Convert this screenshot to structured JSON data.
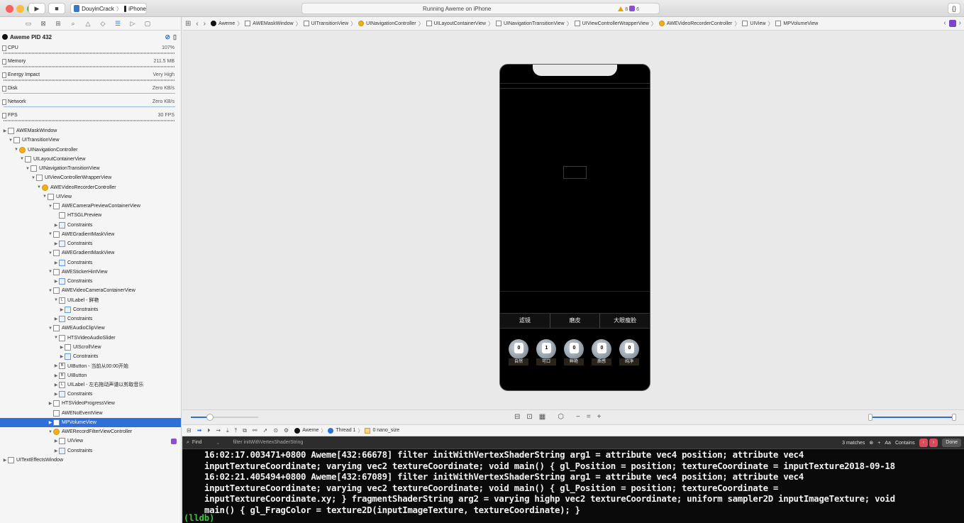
{
  "toolbar": {
    "scheme_app": "DouyinCrack",
    "scheme_device": "iPhone",
    "status": "Running Aweme on iPhone",
    "warnings": "8",
    "issues": "6",
    "right_btn": "{}"
  },
  "navigator": {
    "process": "Aweme PID 432",
    "gauges": [
      {
        "name": "CPU",
        "value": "107%"
      },
      {
        "name": "Memory",
        "value": "211.5 MB"
      },
      {
        "name": "Energy Impact",
        "value": "Very High"
      },
      {
        "name": "Disk",
        "value": "Zero KB/s"
      },
      {
        "name": "Network",
        "value": "Zero KB/s"
      },
      {
        "name": "FPS",
        "value": "30 FPS"
      }
    ],
    "tree": [
      "AWEMaskWindow",
      "UITransitionView",
      "UINavigationController",
      "UILayoutContainerView",
      "UINavigationTransitionView",
      "UIViewControllerWrapperView",
      "AWEVideoRecorderController",
      "UIView",
      "AWECameraPreviewContainerView",
      "HTSGLPreview",
      "Constraints",
      "AWEGradientMaskView",
      "Constraints",
      "AWEGradientMaskView",
      "Constraints",
      "AWEStickerHintView",
      "Constraints",
      "AWEVideoCameraContainerView",
      "UILabel - 鲜艳",
      "Constraints",
      "Constraints",
      "AWEAudioClipView",
      "HTSVideoAudioSlider",
      "UIScrollView",
      "Constraints",
      "UIButton - 当前从00:00开始",
      "UIButton",
      "UILabel - 左右拖动声谱以剪取音乐",
      "Constraints",
      "HTSVideoProgressView",
      "AWENoEventView",
      "MPVolumeView",
      "AWERecordFilterViewController",
      "UIView",
      "Constraints",
      "UITextEffectsWindow"
    ]
  },
  "jumpbar": {
    "crumbs": [
      "Aweme",
      "AWEMaskWindow",
      "UITransitionView",
      "UINavigationController",
      "UILayoutContainerView",
      "UINavigationTransitionView",
      "UIViewControllerWrapperView",
      "AWEVideoRecorderController",
      "UIView",
      "MPVolumeView"
    ]
  },
  "phone": {
    "tabs": [
      "滤镜",
      "磨皮",
      "大眼瘦脸"
    ],
    "filters": [
      {
        "num": "0",
        "label": "自然"
      },
      {
        "num": "1",
        "label": "可口"
      },
      {
        "num": "0",
        "label": "鲜艳"
      },
      {
        "num": "0",
        "label": "质感"
      },
      {
        "num": "0",
        "label": "纯净"
      }
    ]
  },
  "debugbar": {
    "app": "Aweme",
    "thread": "Thread 1",
    "frame": "0 nano_size"
  },
  "console": {
    "find_label": "Find",
    "filter_placeholder": "filter initWithVertexShaderString",
    "matches": "3 matches",
    "aa": "Aa",
    "contains": "Contains",
    "done": "Done",
    "lines": [
      "16:02:17.003471+0800 Aweme[432:66678] filter initWithVertexShaderString arg1 = attribute vec4 position; attribute vec4",
      "inputTextureCoordinate; varying vec2 textureCoordinate; void main() { gl_Position = position; textureCoordinate = inputTexture2018-09-18",
      "16:02:21.405494+0800 Aweme[432:67089] filter initWithVertexShaderString arg1 = attribute vec4 position; attribute vec4",
      "inputTextureCoordinate; varying vec2 textureCoordinate; void main() { gl_Position = position; textureCoordinate =",
      "inputTextureCoordinate.xy; } fragmentShaderString arg2 = varying highp vec2 textureCoordinate; uniform sampler2D inputImageTexture; void",
      "main() { gl_FragColor = texture2D(inputImageTexture, textureCoordinate); }"
    ],
    "prompt": "(lldb)"
  }
}
